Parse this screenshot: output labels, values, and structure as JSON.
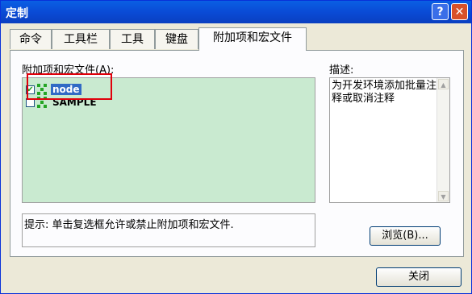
{
  "window": {
    "title": "定制",
    "help_label": "?",
    "close_label": "✕"
  },
  "tabs": [
    "命令",
    "工具栏",
    "工具",
    "键盘",
    "附加项和宏文件"
  ],
  "addins": {
    "label": "附加项和宏文件(A):",
    "items": [
      {
        "name": "node",
        "checked": true,
        "selected": true
      },
      {
        "name": "SAMPLE",
        "checked": false,
        "selected": false
      }
    ]
  },
  "description": {
    "label": "描述:",
    "text": "为开发环境添加批量注释或取消注释"
  },
  "hint": "提示: 单击复选框允许或禁止附加项和宏文件.",
  "buttons": {
    "browse": "浏览(B)...",
    "close": "关闭"
  },
  "icons": {
    "checkbox_mark": "✔",
    "scroll_up": "▲",
    "scroll_down": "▼",
    "addin_icon": "addin-icon"
  }
}
